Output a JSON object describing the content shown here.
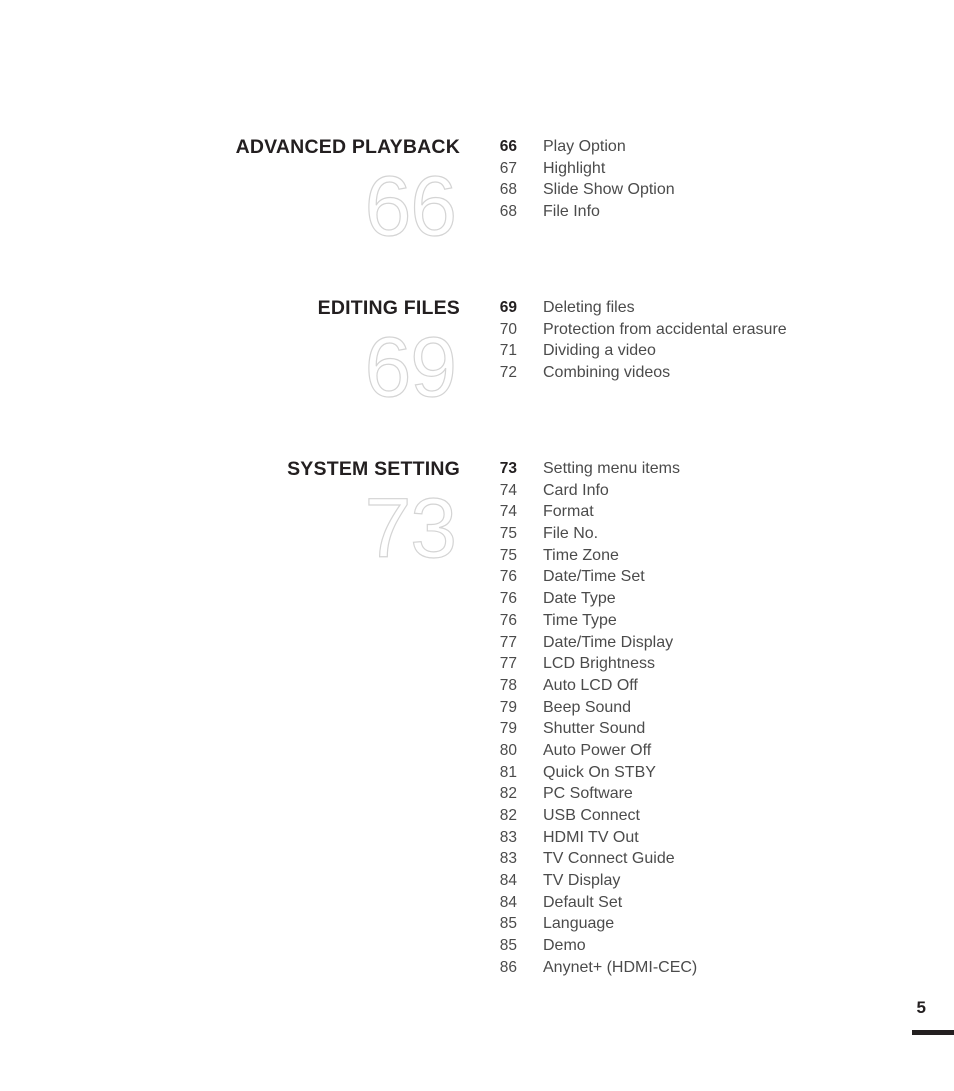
{
  "page": {
    "folio": "5",
    "folio_rule_color": "#231f20",
    "heading_color": "#231f20",
    "entry_color": "#4b4b4b",
    "ghost_numeral_color": "#d4d4d4"
  },
  "sections": [
    {
      "heading": "ADVANCED PLAYBACK",
      "ghost": "66",
      "entries": [
        {
          "page": "66",
          "label": "Play Option"
        },
        {
          "page": "67",
          "label": "Highlight"
        },
        {
          "page": "68",
          "label": "Slide Show Option"
        },
        {
          "page": "68",
          "label": "File Info"
        }
      ]
    },
    {
      "heading": "EDITING FILES",
      "ghost": "69",
      "entries": [
        {
          "page": "69",
          "label": "Deleting files"
        },
        {
          "page": "70",
          "label": "Protection from accidental erasure"
        },
        {
          "page": "71",
          "label": "Dividing a video"
        },
        {
          "page": "72",
          "label": "Combining videos"
        }
      ]
    },
    {
      "heading": "SYSTEM SETTING",
      "ghost": "73",
      "entries": [
        {
          "page": "73",
          "label": "Setting menu items"
        },
        {
          "page": "74",
          "label": "Card Info"
        },
        {
          "page": "74",
          "label": "Format"
        },
        {
          "page": "75",
          "label": "File No."
        },
        {
          "page": "75",
          "label": "Time Zone"
        },
        {
          "page": "76",
          "label": "Date/Time Set"
        },
        {
          "page": "76",
          "label": "Date Type"
        },
        {
          "page": "76",
          "label": "Time Type"
        },
        {
          "page": "77",
          "label": "Date/Time Display"
        },
        {
          "page": "77",
          "label": "LCD Brightness"
        },
        {
          "page": "78",
          "label": "Auto LCD Off"
        },
        {
          "page": "79",
          "label": "Beep Sound"
        },
        {
          "page": "79",
          "label": "Shutter Sound"
        },
        {
          "page": "80",
          "label": "Auto Power Off"
        },
        {
          "page": "81",
          "label": "Quick On STBY"
        },
        {
          "page": "82",
          "label": "PC Software"
        },
        {
          "page": "82",
          "label": "USB Connect"
        },
        {
          "page": "83",
          "label": "HDMI TV Out"
        },
        {
          "page": "83",
          "label": "TV Connect Guide"
        },
        {
          "page": "84",
          "label": "TV Display"
        },
        {
          "page": "84",
          "label": "Default Set"
        },
        {
          "page": "85",
          "label": "Language"
        },
        {
          "page": "85",
          "label": "Demo"
        },
        {
          "page": "86",
          "label": "Anynet+ (HDMI-CEC)"
        }
      ]
    }
  ]
}
